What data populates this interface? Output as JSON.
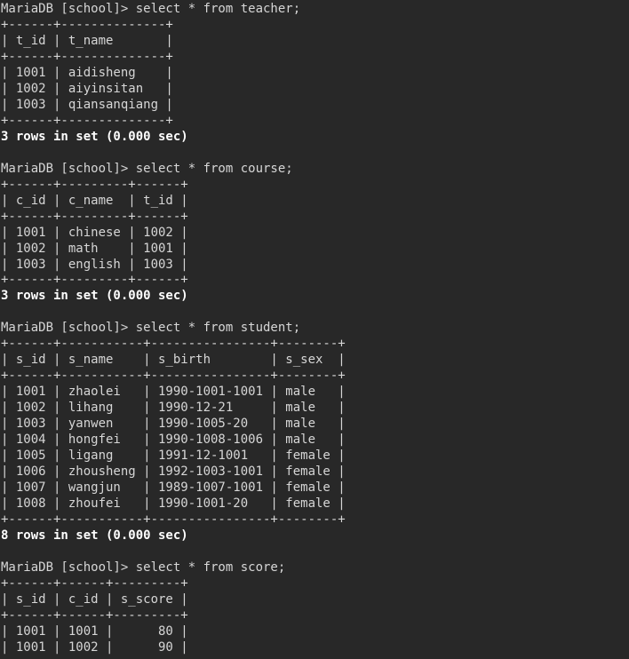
{
  "terminal": {
    "background_color": "#282828",
    "text_color": "#d6d6d6",
    "bold_text_color": "#ffffff",
    "prompt": "MariaDB [school]> ",
    "blocks": [
      {
        "name": "teacher-query-block",
        "command": "MariaDB [school]> select * from teacher;",
        "separator": "+------+--------------+",
        "header": "| t_id | t_name       |",
        "rows": [
          "| 1001 | aidisheng    |",
          "| 1002 | aiyinsitan   |",
          "| 1003 | qiansanqiang |"
        ],
        "status": "3 rows in set (0.000 sec)",
        "columns": [
          "t_id",
          "t_name"
        ],
        "data": [
          [
            "1001",
            "aidisheng"
          ],
          [
            "1002",
            "aiyinsitan"
          ],
          [
            "1003",
            "qiansanqiang"
          ]
        ]
      },
      {
        "name": "course-query-block",
        "command": "MariaDB [school]> select * from course;",
        "separator": "+------+---------+------+",
        "header": "| c_id | c_name  | t_id |",
        "rows": [
          "| 1001 | chinese | 1002 |",
          "| 1002 | math    | 1001 |",
          "| 1003 | english | 1003 |"
        ],
        "status": "3 rows in set (0.000 sec)",
        "columns": [
          "c_id",
          "c_name",
          "t_id"
        ],
        "data": [
          [
            "1001",
            "chinese",
            "1002"
          ],
          [
            "1002",
            "math",
            "1001"
          ],
          [
            "1003",
            "english",
            "1003"
          ]
        ]
      },
      {
        "name": "student-query-block",
        "command": "MariaDB [school]> select * from student;",
        "separator": "+------+-----------+----------------+--------+",
        "header": "| s_id | s_name    | s_birth        | s_sex  |",
        "rows": [
          "| 1001 | zhaolei   | 1990-1001-1001 | male   |",
          "| 1002 | lihang    | 1990-12-21     | male   |",
          "| 1003 | yanwen    | 1990-1005-20   | male   |",
          "| 1004 | hongfei   | 1990-1008-1006 | male   |",
          "| 1005 | ligang    | 1991-12-1001   | female |",
          "| 1006 | zhousheng | 1992-1003-1001 | female |",
          "| 1007 | wangjun   | 1989-1007-1001 | female |",
          "| 1008 | zhoufei   | 1990-1001-20   | female |"
        ],
        "status": "8 rows in set (0.000 sec)",
        "columns": [
          "s_id",
          "s_name",
          "s_birth",
          "s_sex"
        ],
        "data": [
          [
            "1001",
            "zhaolei",
            "1990-1001-1001",
            "male"
          ],
          [
            "1002",
            "lihang",
            "1990-12-21",
            "male"
          ],
          [
            "1003",
            "yanwen",
            "1990-1005-20",
            "male"
          ],
          [
            "1004",
            "hongfei",
            "1990-1008-1006",
            "male"
          ],
          [
            "1005",
            "ligang",
            "1991-12-1001",
            "female"
          ],
          [
            "1006",
            "zhousheng",
            "1992-1003-1001",
            "female"
          ],
          [
            "1007",
            "wangjun",
            "1989-1007-1001",
            "female"
          ],
          [
            "1008",
            "zhoufei",
            "1990-1001-20",
            "female"
          ]
        ]
      },
      {
        "name": "score-query-block",
        "command": "MariaDB [school]> select * from score;",
        "separator": "+------+------+---------+",
        "header": "| s_id | c_id | s_score |",
        "rows": [
          "| 1001 | 1001 |      80 |",
          "| 1001 | 1002 |      90 |"
        ],
        "status": "",
        "columns": [
          "s_id",
          "c_id",
          "s_score"
        ],
        "data": [
          [
            "1001",
            "1001",
            "80"
          ],
          [
            "1001",
            "1002",
            "90"
          ]
        ],
        "truncated": true
      }
    ]
  }
}
